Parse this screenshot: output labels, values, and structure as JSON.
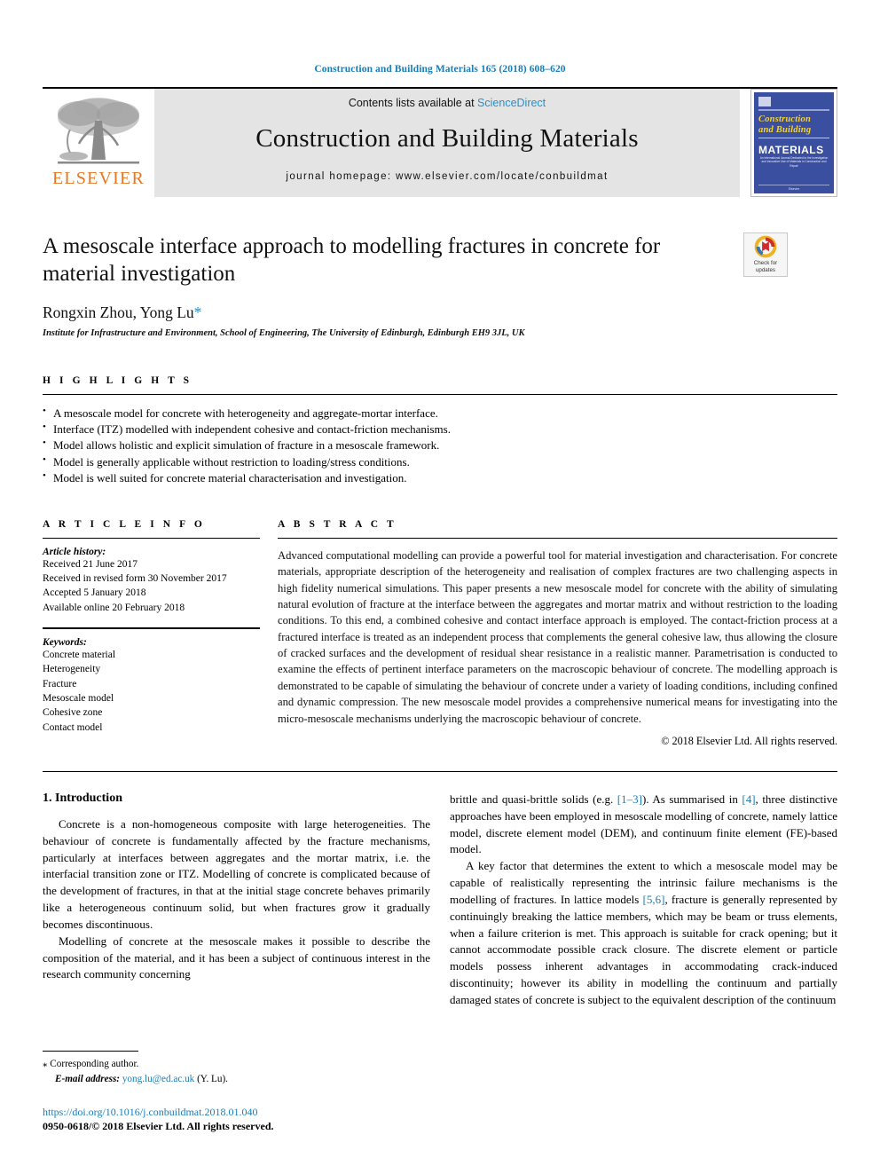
{
  "running_head": "Construction and Building Materials 165 (2018) 608–620",
  "masthead": {
    "publisher_name": "ELSEVIER",
    "contents_prefix": "Contents lists available at ",
    "contents_link": "ScienceDirect",
    "journal_title": "Construction and Building Materials",
    "homepage": "journal homepage: www.elsevier.com/locate/conbuildmat",
    "cover": {
      "line1": "Construction",
      "line2": "and Building",
      "line3": "MATERIALS",
      "blurb": "An International Journal Dedicated to the Investigation and Innovative Use of Materials in Construction and Repair",
      "foot": "Elsevier"
    }
  },
  "article": {
    "title": "A mesoscale interface approach to modelling fractures in concrete for material investigation",
    "authors": "Rongxin Zhou, Yong Lu",
    "corresponding_marker": "*",
    "affiliation": "Institute for Infrastructure and Environment, School of Engineering, The University of Edinburgh, Edinburgh EH9 3JL, UK",
    "crossmark_label_1": "Check for",
    "crossmark_label_2": "updates"
  },
  "highlights": {
    "label": "H I G H L I G H T S",
    "items": [
      "A mesoscale model for concrete with heterogeneity and aggregate-mortar interface.",
      "Interface (ITZ) modelled with independent cohesive and contact-friction mechanisms.",
      "Model allows holistic and explicit simulation of fracture in a mesoscale framework.",
      "Model is generally applicable without restriction to loading/stress conditions.",
      "Model is well suited for concrete material characterisation and investigation."
    ]
  },
  "article_info": {
    "label": "A R T I C L E   I N F O",
    "history_title": "Article history:",
    "history": [
      "Received 21 June 2017",
      "Received in revised form 30 November 2017",
      "Accepted 5 January 2018",
      "Available online 20 February 2018"
    ],
    "keywords_title": "Keywords:",
    "keywords": [
      "Concrete material",
      "Heterogeneity",
      "Fracture",
      "Mesoscale model",
      "Cohesive zone",
      "Contact model"
    ]
  },
  "abstract": {
    "label": "A B S T R A C T",
    "text": "Advanced computational modelling can provide a powerful tool for material investigation and characterisation. For concrete materials, appropriate description of the heterogeneity and realisation of complex fractures are two challenging aspects in high fidelity numerical simulations. This paper presents a new mesoscale model for concrete with the ability of simulating natural evolution of fracture at the interface between the aggregates and mortar matrix and without restriction to the loading conditions. To this end, a combined cohesive and contact interface approach is employed. The contact-friction process at a fractured interface is treated as an independent process that complements the general cohesive law, thus allowing the closure of cracked surfaces and the development of residual shear resistance in a realistic manner. Parametrisation is conducted to examine the effects of pertinent interface parameters on the macroscopic behaviour of concrete. The modelling approach is demonstrated to be capable of simulating the behaviour of concrete under a variety of loading conditions, including confined and dynamic compression. The new mesoscale model provides a comprehensive numerical means for investigating into the micro-mesoscale mechanisms underlying the macroscopic behaviour of concrete.",
    "copyright": "© 2018 Elsevier Ltd. All rights reserved."
  },
  "body": {
    "section_heading": "1. Introduction",
    "left_paragraphs": [
      "Concrete is a non-homogeneous composite with large heterogeneities. The behaviour of concrete is fundamentally affected by the fracture mechanisms, particularly at interfaces between aggregates and the mortar matrix, i.e. the interfacial transition zone or ITZ. Modelling of concrete is complicated because of the development of fractures, in that at the initial stage concrete behaves primarily like a heterogeneous continuum solid, but when fractures grow it gradually becomes discontinuous.",
      "Modelling of concrete at the mesoscale makes it possible to describe the composition of the material, and it has been a subject of continuous interest in the research community concerning"
    ],
    "right_paragraph_1_a": "brittle and quasi-brittle solids (e.g. ",
    "right_paragraph_1_ref1": "[1–3]",
    "right_paragraph_1_b": "). As summarised in ",
    "right_paragraph_1_ref2": "[4]",
    "right_paragraph_1_c": ", three distinctive approaches have been employed in mesoscale modelling of concrete, namely lattice model, discrete element model (DEM), and continuum finite element (FE)-based model.",
    "right_paragraph_2_a": "A key factor that determines the extent to which a mesoscale model may be capable of realistically representing the intrinsic failure mechanisms is the modelling of fractures. In lattice models ",
    "right_paragraph_2_ref": "[5,6]",
    "right_paragraph_2_b": ", fracture is generally represented by continuingly breaking the lattice members, which may be beam or truss elements, when a failure criterion is met. This approach is suitable for crack opening; but it cannot accommodate possible crack closure. The discrete element or particle models possess inherent advantages in accommodating crack-induced discontinuity; however its ability in modelling the continuum and partially damaged states of concrete is subject to the equivalent description of the continuum"
  },
  "footer": {
    "corresponding_star": "⁎",
    "corresponding_label": "Corresponding author.",
    "email_label": "E-mail address:",
    "email": "yong.lu@ed.ac.uk",
    "email_suffix": "(Y. Lu).",
    "doi": "https://doi.org/10.1016/j.conbuildmat.2018.01.040",
    "issn": "0950-0618/© 2018 Elsevier Ltd. All rights reserved."
  },
  "colors": {
    "link_blue": "#1a7db6",
    "elsevier_orange": "#E87722",
    "cover_blue": "#3b4fa0",
    "cover_yellow": "#f2d23c",
    "band_grey": "#e4e4e4"
  }
}
